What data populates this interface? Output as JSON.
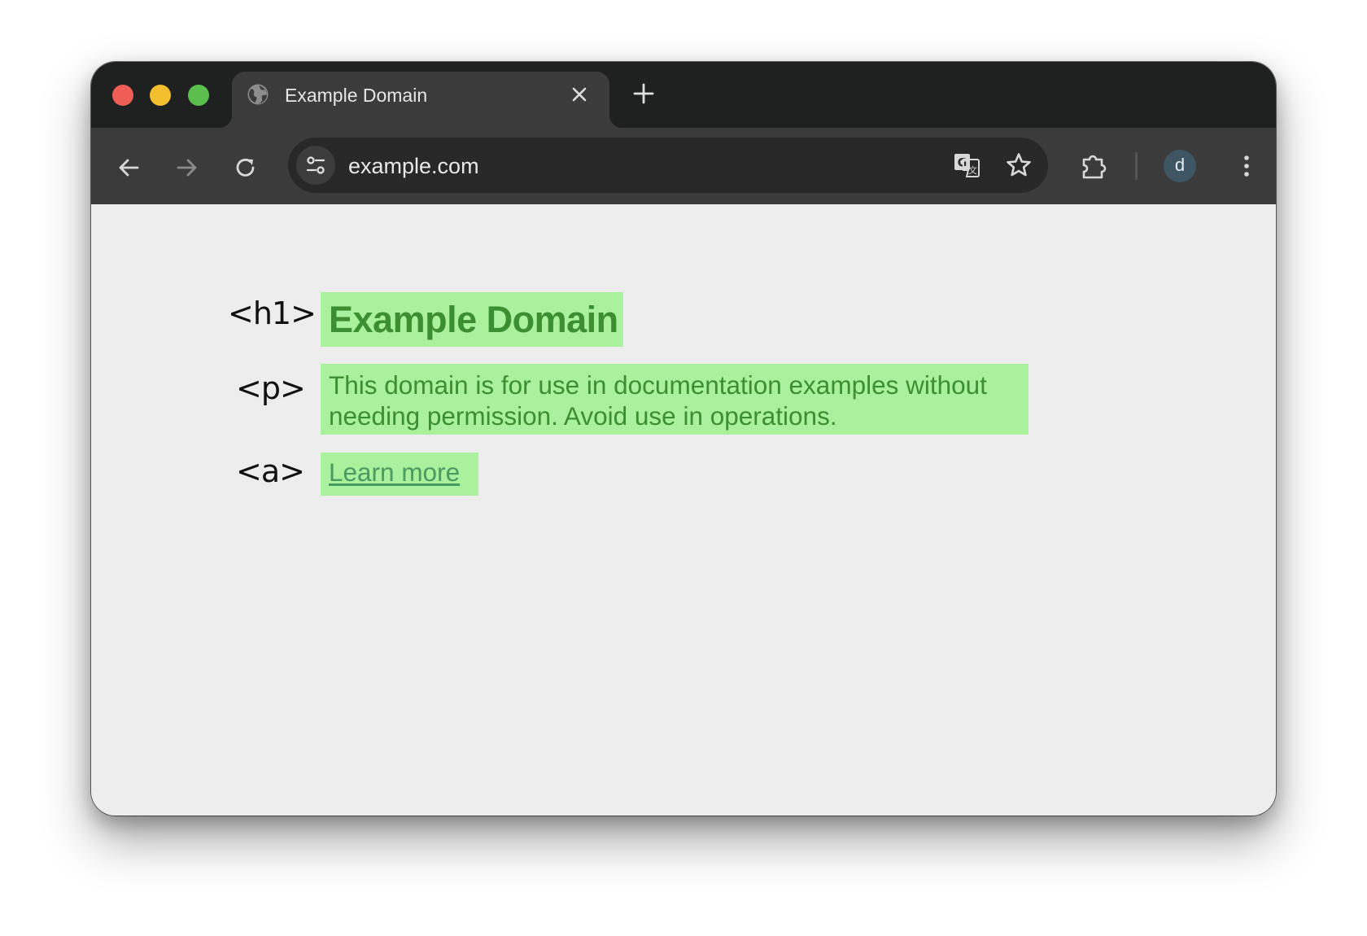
{
  "browser": {
    "tab": {
      "title": "Example Domain",
      "favicon_icon": "globe-icon",
      "close_icon": "close-icon"
    },
    "new_tab_icon": "plus-icon",
    "toolbar": {
      "back_icon": "arrow-left-icon",
      "forward_icon": "arrow-right-icon",
      "reload_icon": "reload-icon",
      "site_info_icon": "tune-icon",
      "url": "example.com",
      "translate_icon": "translate-icon",
      "bookmark_icon": "star-icon",
      "extensions_icon": "puzzle-icon",
      "profile_initial": "d",
      "menu_icon": "kebab-menu-icon"
    },
    "colors": {
      "traffic_close": "#ee5e57",
      "traffic_minimize": "#f3bf2f",
      "traffic_maximize": "#5bbf4e",
      "highlight": "#a9f19c",
      "text_green": "#3c8f31"
    }
  },
  "page": {
    "labels": {
      "h1": "<h1>",
      "p": "<p>",
      "a": "<a>"
    },
    "heading": "Example Domain",
    "paragraph": "This domain is for use in documentation examples without needing permission. Avoid use in operations.",
    "link": "Learn more"
  }
}
